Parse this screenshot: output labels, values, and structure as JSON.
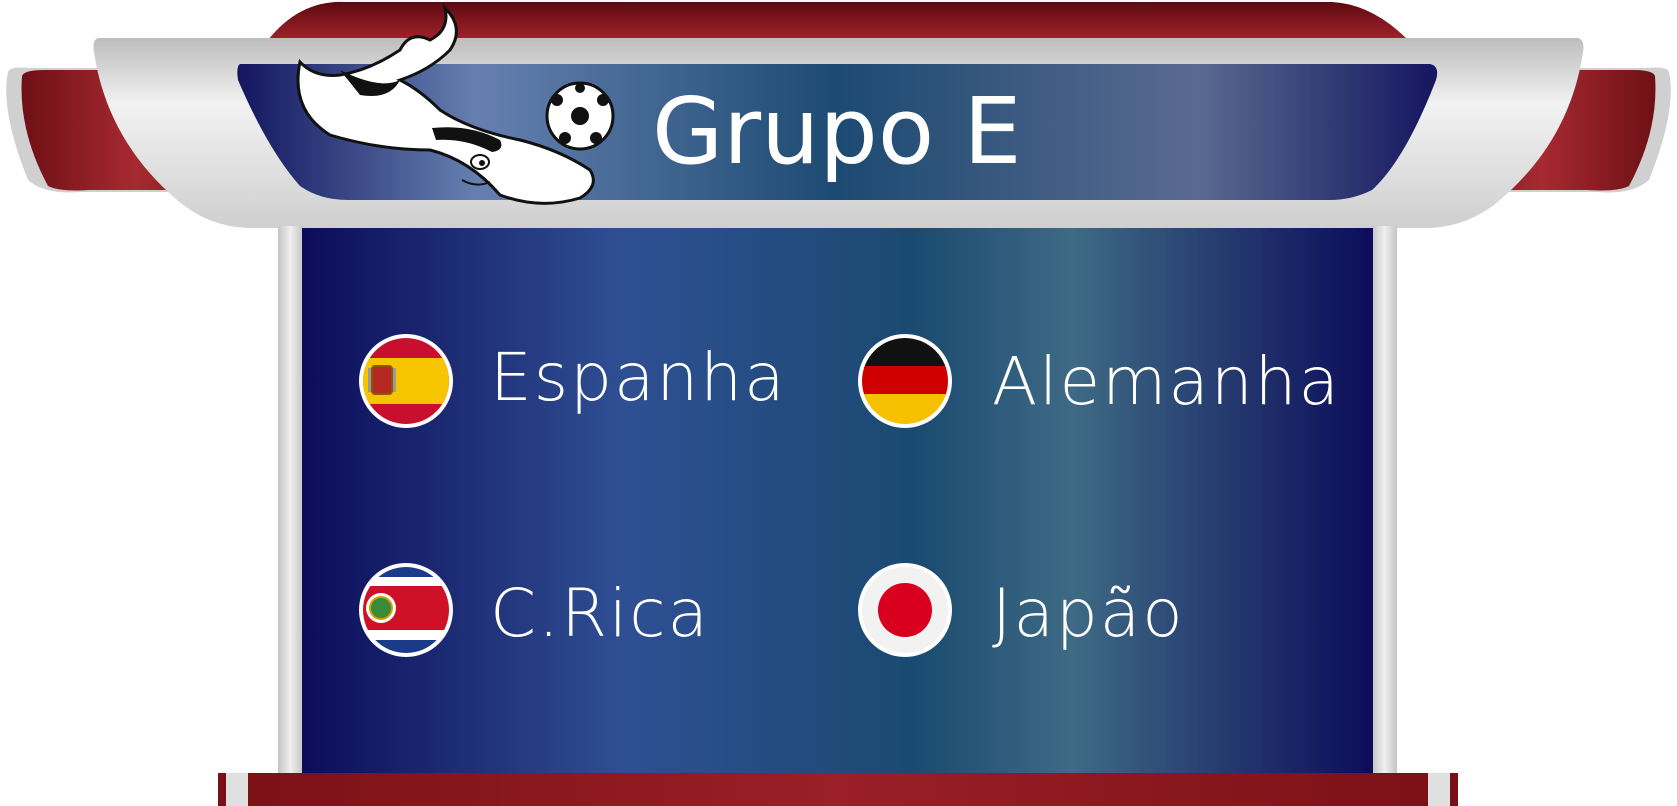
{
  "group": {
    "title": "Grupo E",
    "mascot_icon": "laeeb-mascot-icon",
    "ball_icon": "soccer-ball-icon"
  },
  "teams": [
    {
      "name": "Espanha",
      "flag_icon": "spain-flag-icon"
    },
    {
      "name": "Alemanha",
      "flag_icon": "germany-flag-icon"
    },
    {
      "name": "C.Rica",
      "flag_icon": "costa-rica-flag-icon"
    },
    {
      "name": "Japão",
      "flag_icon": "japan-flag-icon"
    }
  ],
  "colors": {
    "board_dark": "#0c0e5c",
    "board_mid": "#2d4e92",
    "frame_silver": "#d6d6d6",
    "roof_red": "#8b1a1e"
  }
}
